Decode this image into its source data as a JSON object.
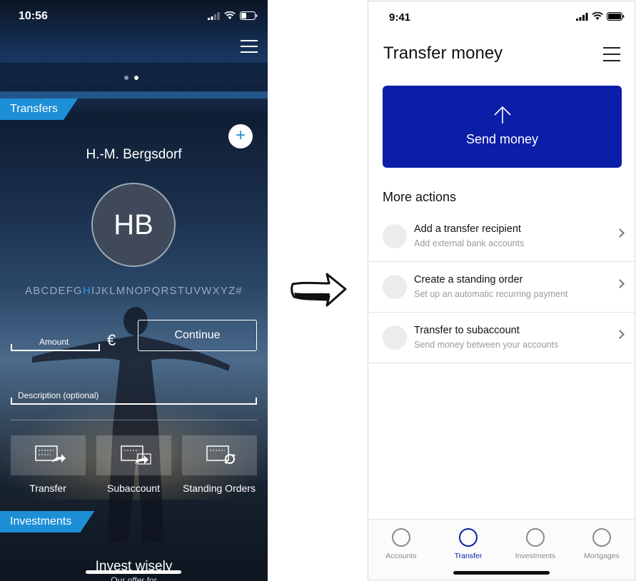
{
  "old_screen": {
    "status": {
      "time": "10:56"
    },
    "transfers_tag": "Transfers",
    "add_button": "+",
    "recipient_name": "H.-M. Bergsdorf",
    "avatar_initials": "HB",
    "alphabet_before": "ABCDEFG",
    "alphabet_highlight": "H",
    "alphabet_after": "IJKLMNOPQRSTUVWXYZ#",
    "amount_label": "Amount",
    "currency_symbol": "€",
    "continue_label": "Continue",
    "description_label": "Description (optional)",
    "tiles": [
      {
        "label": "Transfer"
      },
      {
        "label": "Subaccount"
      },
      {
        "label": "Standing Orders"
      }
    ],
    "investments_tag": "Investments",
    "invest_title": "Invest wisely",
    "invest_subtitle": "Our offer for"
  },
  "new_screen": {
    "status": {
      "time": "9:41"
    },
    "title": "Transfer money",
    "send_money_label": "Send money",
    "more_actions_title": "More actions",
    "actions": [
      {
        "title": "Add a transfer recipient",
        "subtitle": "Add external bank accounts"
      },
      {
        "title": "Create a standing order",
        "subtitle": "Set up an automatic recurring payment"
      },
      {
        "title": "Transfer to subaccount",
        "subtitle": "Send money between your accounts"
      }
    ],
    "tabs": [
      {
        "label": "Accounts",
        "active": false
      },
      {
        "label": "Transfer",
        "active": true
      },
      {
        "label": "Investments",
        "active": false
      },
      {
        "label": "Mortgages",
        "active": false
      }
    ]
  },
  "colors": {
    "old_accent": "#1c8fd6",
    "new_primary": "#0b1ea8",
    "new_text": "#111111",
    "new_muted": "#9a9a9a"
  },
  "icons": [
    "signal-icon",
    "wifi-icon",
    "battery-icon",
    "hamburger-menu-icon",
    "plus-icon",
    "transfer-icon",
    "subaccount-icon",
    "standing-order-icon",
    "right-arrow-icon",
    "arrow-up-icon",
    "chevron-right-icon"
  ]
}
